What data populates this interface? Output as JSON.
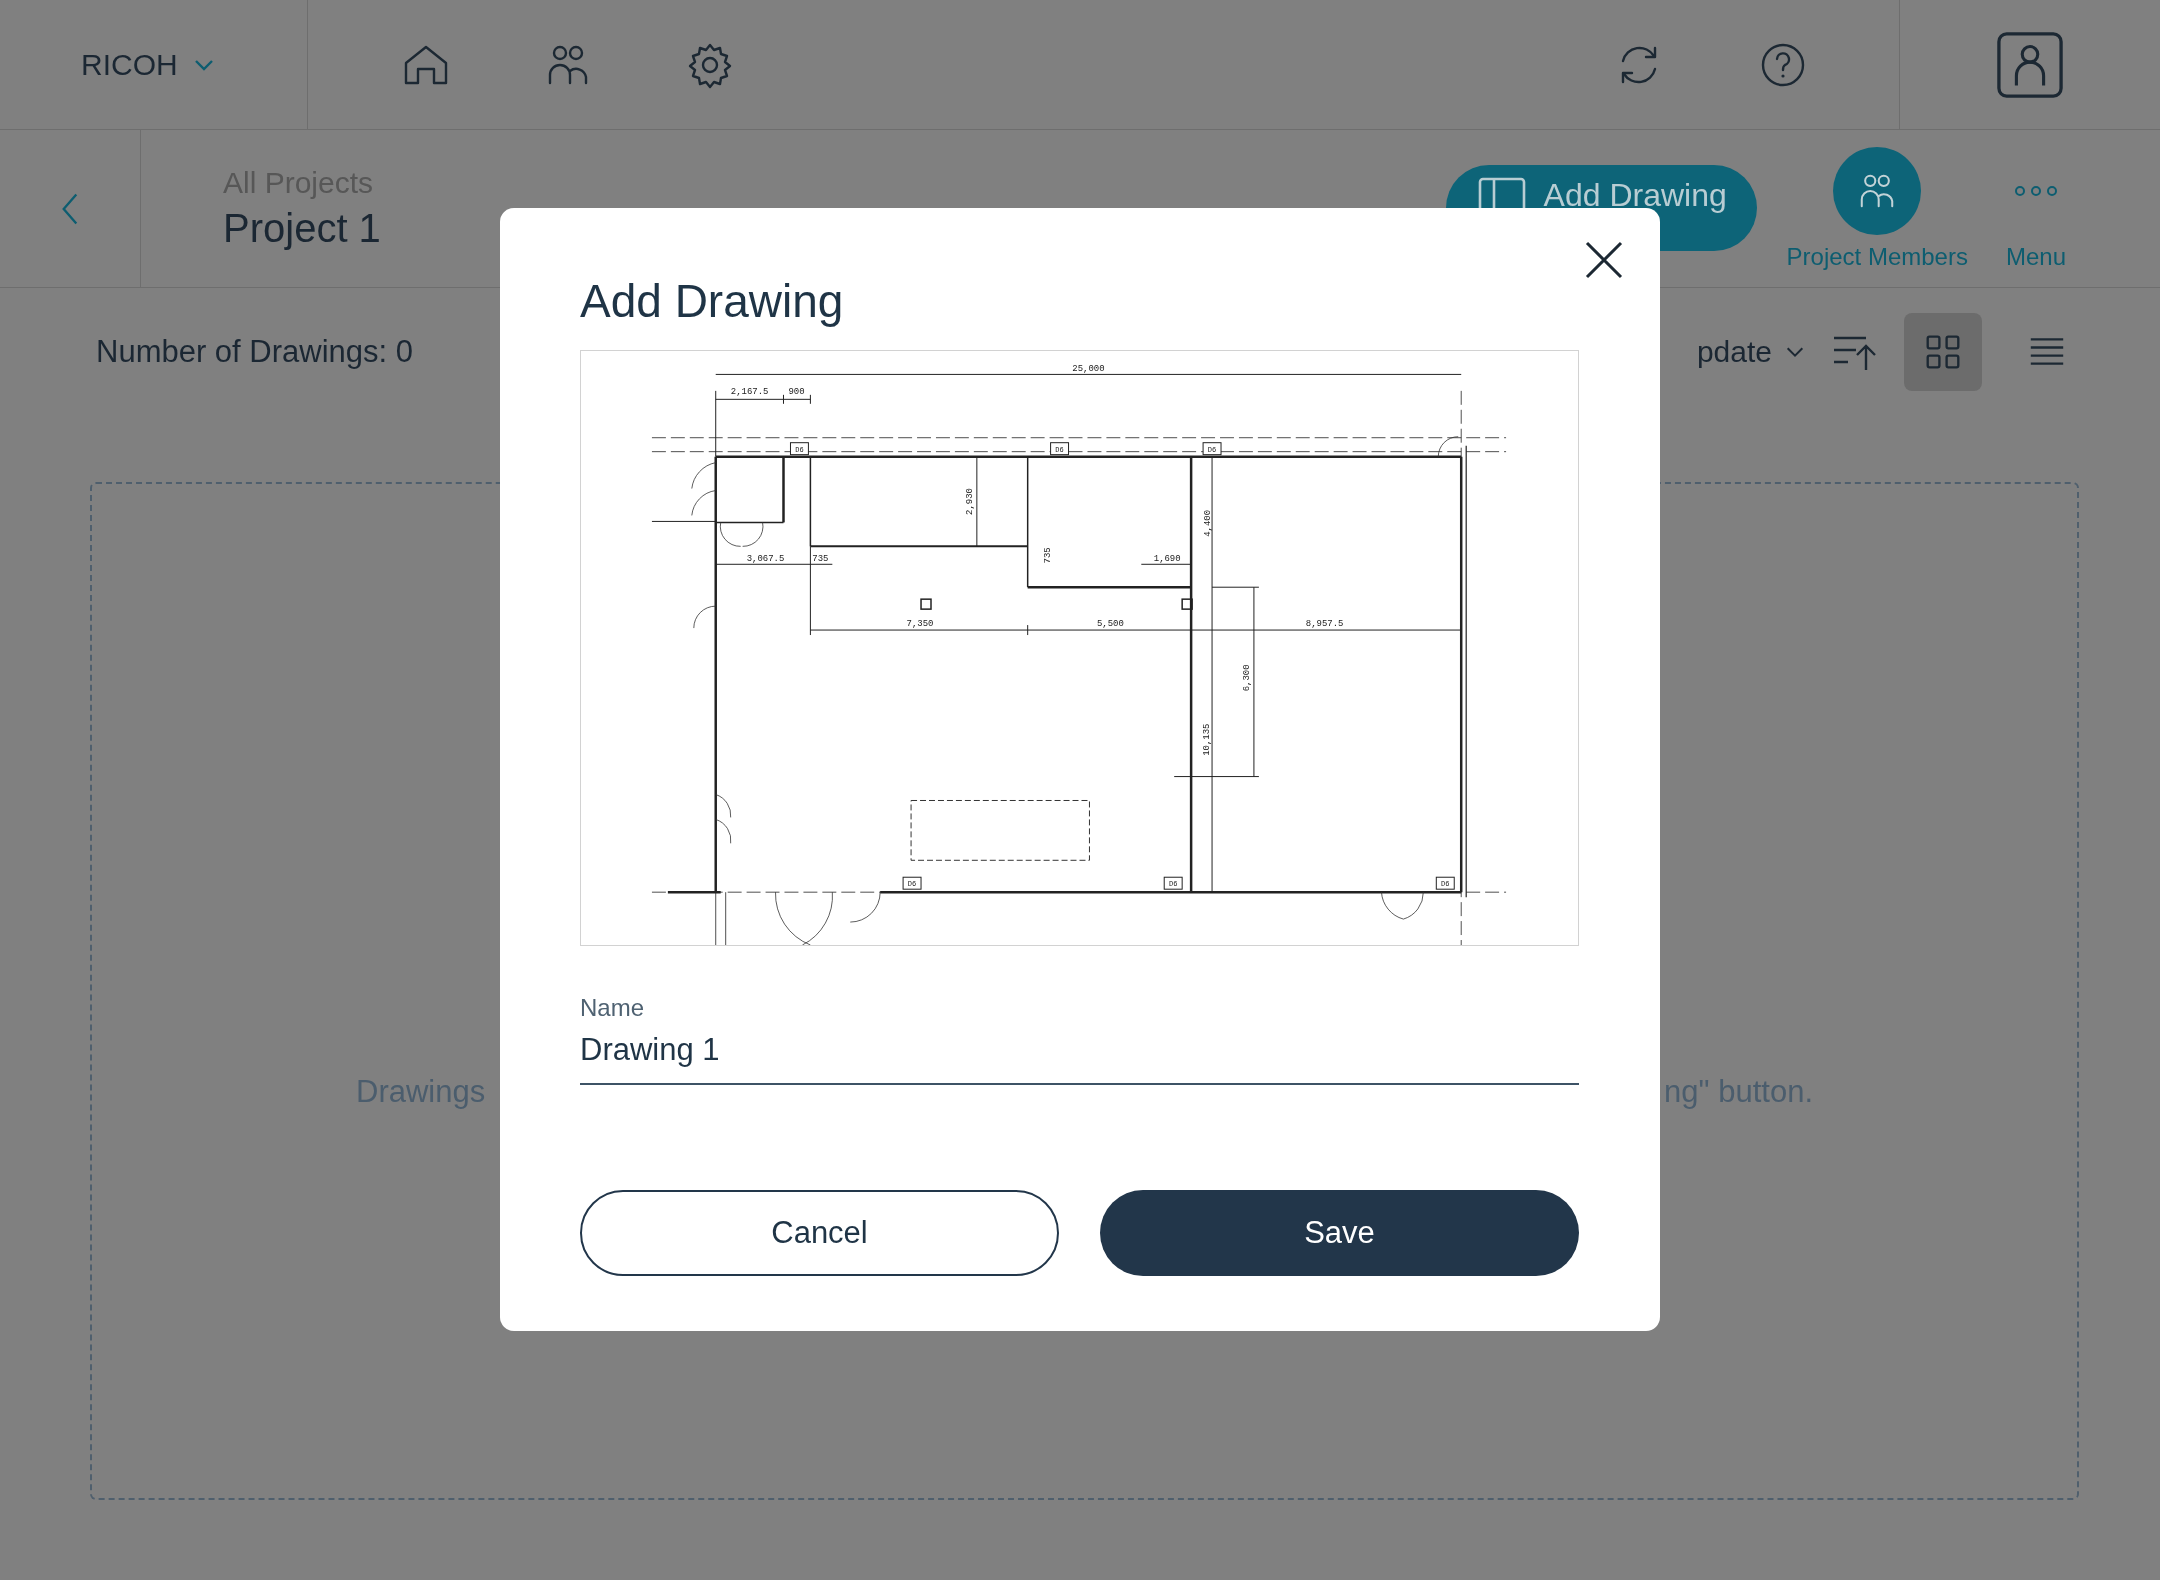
{
  "top_bar": {
    "brand": "RICOH",
    "nav": [
      {
        "kind": "home"
      },
      {
        "kind": "people"
      },
      {
        "kind": "settings"
      }
    ],
    "tools": [
      {
        "kind": "sync"
      },
      {
        "kind": "help"
      }
    ]
  },
  "header": {
    "breadcrumb": "All Projects",
    "title": "Project 1",
    "add_button": "Add Drawing",
    "actions": [
      {
        "label": "Project Members",
        "kind": "members"
      },
      {
        "label": "Menu",
        "kind": "menu"
      }
    ]
  },
  "toolbar": {
    "count": "Number of Drawings: 0",
    "sort_label": "pdate",
    "view_modes": [
      {
        "kind": "grid",
        "selected": true
      },
      {
        "kind": "list",
        "selected": false
      }
    ]
  },
  "empty_message": {
    "left": "Drawings",
    "right": "ng\" button."
  },
  "dialog": {
    "title": "Add Drawing",
    "preview_labels": [
      "25,000",
      "2,167.5",
      "900",
      "3,067.5",
      "735",
      "2,930",
      "735",
      "1,690",
      "4,400",
      "7,350",
      "5,500",
      "8,957.5",
      "6,300",
      "10,135",
      "D6",
      "D6",
      "D6",
      "D6",
      "D6",
      "D6"
    ],
    "name_field": {
      "label": "Name",
      "value": "Drawing 1"
    },
    "buttons": [
      {
        "label": "Cancel",
        "kind": "secondary"
      },
      {
        "label": "Save",
        "kind": "primary"
      }
    ]
  }
}
